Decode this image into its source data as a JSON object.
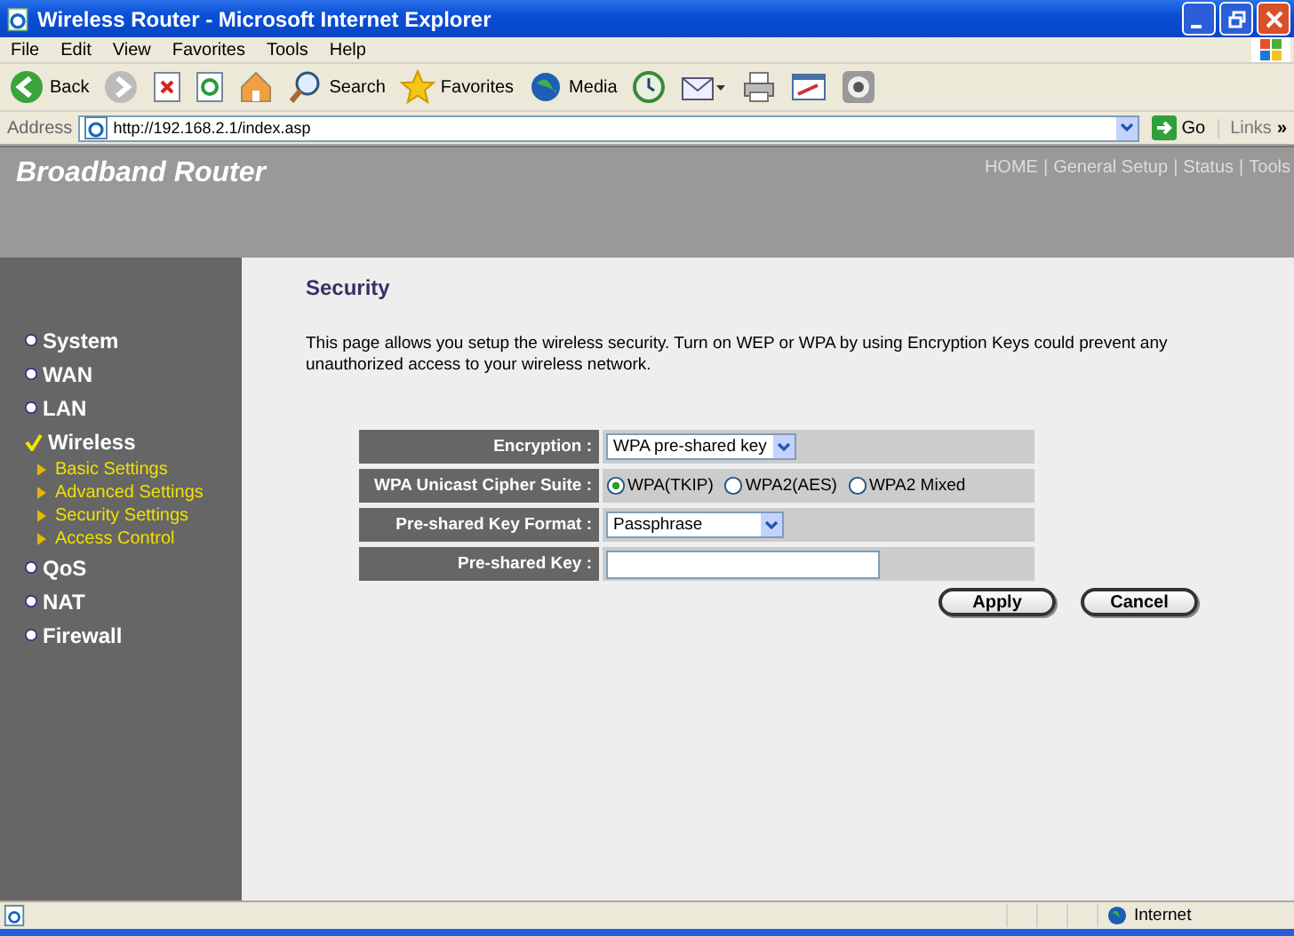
{
  "window": {
    "title": "Wireless Router - Microsoft Internet Explorer"
  },
  "menu_bar": [
    "File",
    "Edit",
    "View",
    "Favorites",
    "Tools",
    "Help"
  ],
  "toolbar": [
    {
      "kind": "back",
      "label": "Back"
    },
    {
      "kind": "forward"
    },
    {
      "kind": "stop"
    },
    {
      "kind": "refresh"
    },
    {
      "kind": "home"
    },
    {
      "kind": "search",
      "label": "Search"
    },
    {
      "kind": "favorites",
      "label": "Favorites"
    },
    {
      "kind": "media",
      "label": "Media"
    },
    {
      "kind": "history"
    },
    {
      "kind": "mail"
    },
    {
      "kind": "print"
    },
    {
      "kind": "edit"
    },
    {
      "kind": "messenger"
    }
  ],
  "address_bar": {
    "label": "Address",
    "url": "http://192.168.2.1/index.asp",
    "go": "Go",
    "links": "Links",
    "more": "»"
  },
  "header": {
    "brand": "Broadband Router",
    "separator": "|",
    "nav": [
      "HOME",
      "General Setup",
      "Status",
      "Tools"
    ]
  },
  "sidebar": {
    "items": [
      {
        "label": "System",
        "selected": false
      },
      {
        "label": "WAN",
        "selected": false
      },
      {
        "label": "LAN",
        "selected": false
      },
      {
        "label": "Wireless",
        "selected": true,
        "children": [
          {
            "label": "Basic Settings"
          },
          {
            "label": "Advanced Settings"
          },
          {
            "label": "Security Settings"
          },
          {
            "label": "Access Control"
          }
        ]
      },
      {
        "label": "QoS",
        "selected": false
      },
      {
        "label": "NAT",
        "selected": false
      },
      {
        "label": "Firewall",
        "selected": false
      }
    ]
  },
  "content": {
    "title": "Security",
    "description": "This page allows you setup the wireless security. Turn on WEP or WPA by using Encryption Keys could prevent any unauthorized access to your wireless network.",
    "form": [
      {
        "kind": "select",
        "label": "Encryption :",
        "value": "WPA pre-shared key"
      },
      {
        "kind": "radio",
        "label": "WPA Unicast Cipher Suite :",
        "options": [
          {
            "label": "WPA(TKIP)",
            "selected": true
          },
          {
            "label": "WPA2(AES)",
            "selected": false
          },
          {
            "label": "WPA2 Mixed",
            "selected": false
          }
        ]
      },
      {
        "kind": "select",
        "label": "Pre-shared Key Format :",
        "value": "Passphrase"
      },
      {
        "kind": "text",
        "label": "Pre-shared Key :"
      }
    ],
    "buttons": [
      "Apply",
      "Cancel"
    ]
  },
  "status_bar": {
    "zone": "Internet"
  }
}
